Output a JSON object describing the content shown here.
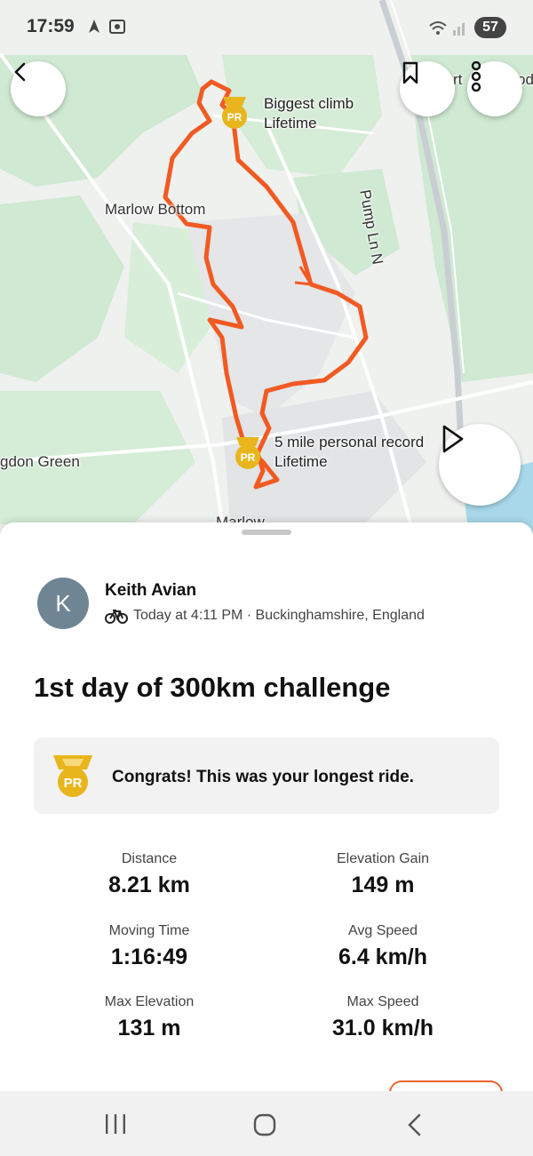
{
  "status_bar": {
    "time": "17:59",
    "battery": "57"
  },
  "map": {
    "labels": {
      "marlow_bottom": "Marlow Bottom",
      "pump_ln": "Pump Ln N",
      "don_green": "gdon Green",
      "marlow": "Marlow",
      "top_right_partial": "rt",
      "top_right_partial2": "od"
    },
    "pr_markers": [
      {
        "badge": "PR",
        "line1": "Biggest climb",
        "line2": "Lifetime"
      },
      {
        "badge": "PR",
        "line1": "5 mile personal record",
        "line2": "Lifetime"
      }
    ]
  },
  "activity": {
    "athlete_initial": "K",
    "athlete_name": "Keith Avian",
    "meta": "Today at 4:11 PM · Buckinghamshire, England",
    "title": "1st day of 300km challenge",
    "achievement": {
      "badge": "PR",
      "text": "Congrats! This was your longest ride."
    },
    "stats": [
      {
        "label": "Distance",
        "value": "8.21 km"
      },
      {
        "label": "Elevation Gain",
        "value": "149 m"
      },
      {
        "label": "Moving Time",
        "value": "1:16:49"
      },
      {
        "label": "Avg Speed",
        "value": "6.4 km/h"
      },
      {
        "label": "Max Elevation",
        "value": "131 m"
      },
      {
        "label": "Max Speed",
        "value": "31.0 km/h"
      }
    ]
  },
  "colors": {
    "route": "#f15a22",
    "pr_gold": "#e8b61c",
    "accent": "#e8642c"
  }
}
